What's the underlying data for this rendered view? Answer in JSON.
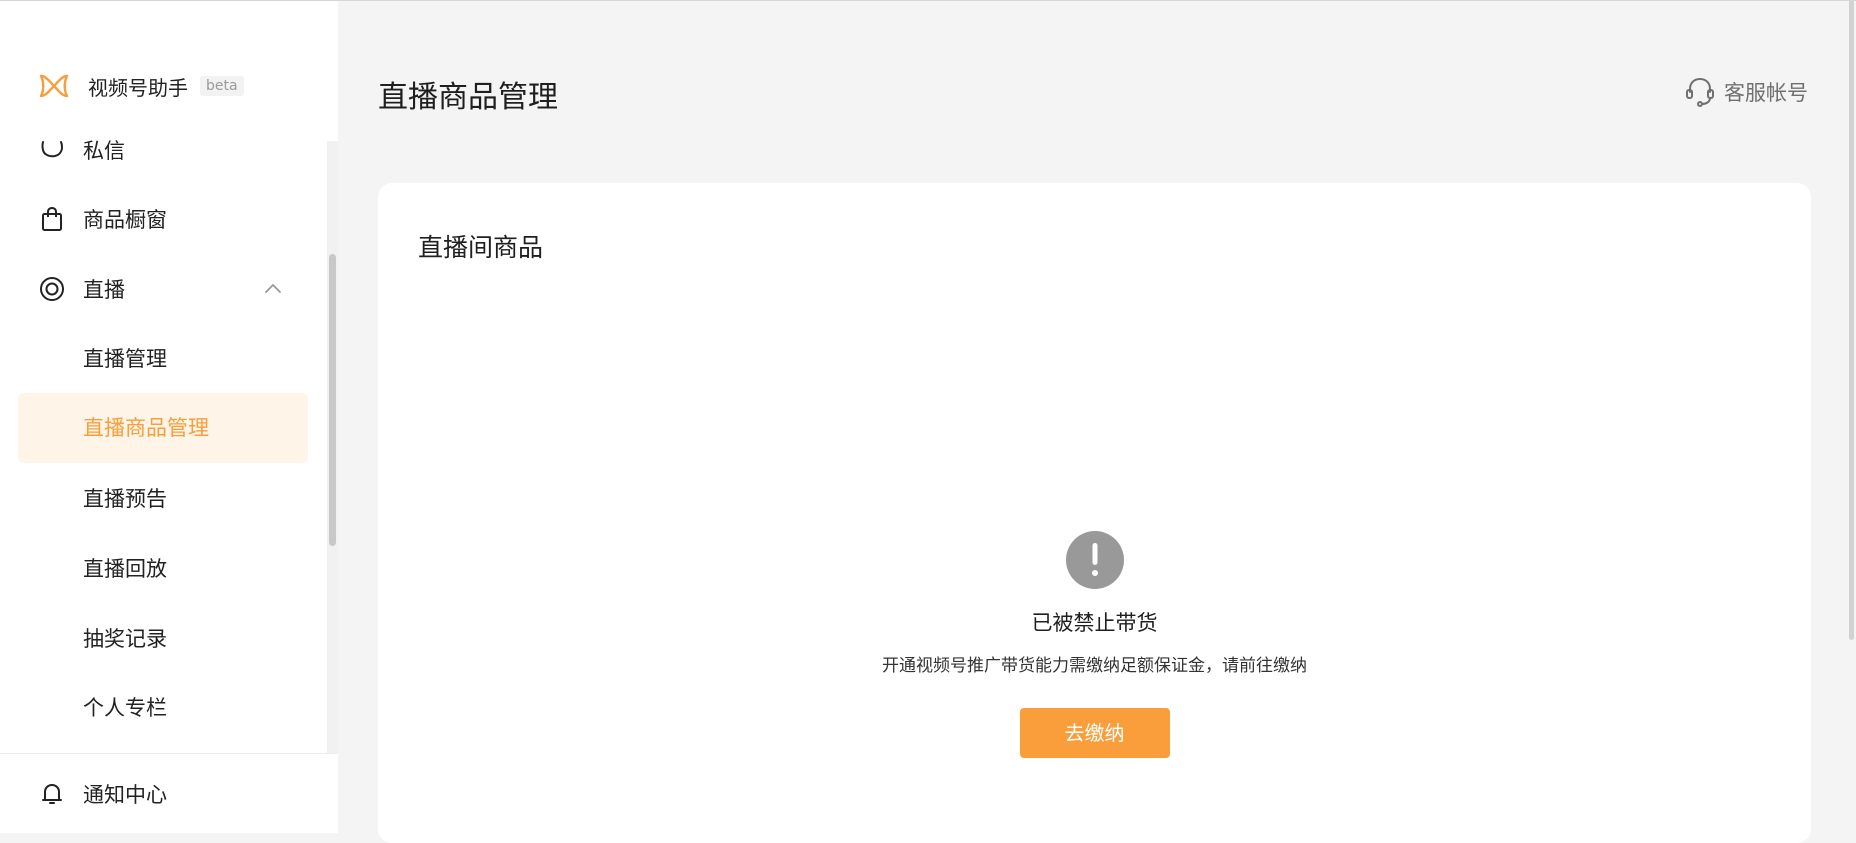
{
  "brand": {
    "name": "视频号助手",
    "badge": "beta",
    "accent": "#fa9d3b"
  },
  "sidebar": {
    "items": [
      {
        "label": "私信",
        "icon": "chat-bubble-icon"
      },
      {
        "label": "商品橱窗",
        "icon": "shopping-bag-icon"
      },
      {
        "label": "直播",
        "icon": "live-circle-icon",
        "expanded": true
      },
      {
        "label": "直播管理"
      },
      {
        "label": "直播商品管理",
        "active": true
      },
      {
        "label": "直播预告"
      },
      {
        "label": "直播回放"
      },
      {
        "label": "抽奖记录"
      },
      {
        "label": "个人专栏"
      }
    ],
    "footer": {
      "label": "通知中心",
      "icon": "bell-icon"
    }
  },
  "header": {
    "title": "直播商品管理",
    "service": {
      "label": "客服帐号",
      "icon": "headset-icon"
    }
  },
  "card": {
    "title": "直播间商品",
    "empty": {
      "icon": "exclamation-icon",
      "title": "已被禁止带货",
      "description": "开通视频号推广带货能力需缴纳足额保证金，请前往缴纳",
      "button": "去缴纳"
    }
  },
  "colors": {
    "accent": "#fa9d3b",
    "active_bg": "#fff4e8",
    "warn_icon": "#999999"
  }
}
